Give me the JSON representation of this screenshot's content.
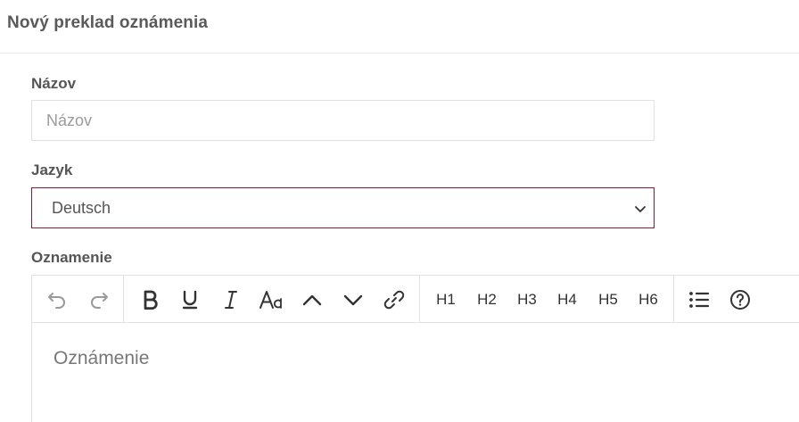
{
  "header": {
    "title": "Nový preklad oznámenia"
  },
  "form": {
    "name_label": "Názov",
    "name_placeholder": "Názov",
    "name_value": "",
    "language_label": "Jazyk",
    "language_value": "Deutsch",
    "announcement_label": "Oznamenie",
    "announcement_placeholder": "Oznámenie"
  },
  "toolbar": {
    "headings": [
      "H1",
      "H2",
      "H3",
      "H4",
      "H5",
      "H6"
    ],
    "icons": [
      "undo-icon",
      "redo-icon",
      "bold-icon",
      "underline-icon",
      "italic-icon",
      "font-size-icon",
      "chevron-up-icon",
      "chevron-down-icon",
      "link-icon",
      "bullet-list-icon",
      "help-icon"
    ]
  },
  "colors": {
    "select_border": "#8b1a34",
    "icon": "#333333",
    "icon_disabled": "#9a9a9a"
  }
}
